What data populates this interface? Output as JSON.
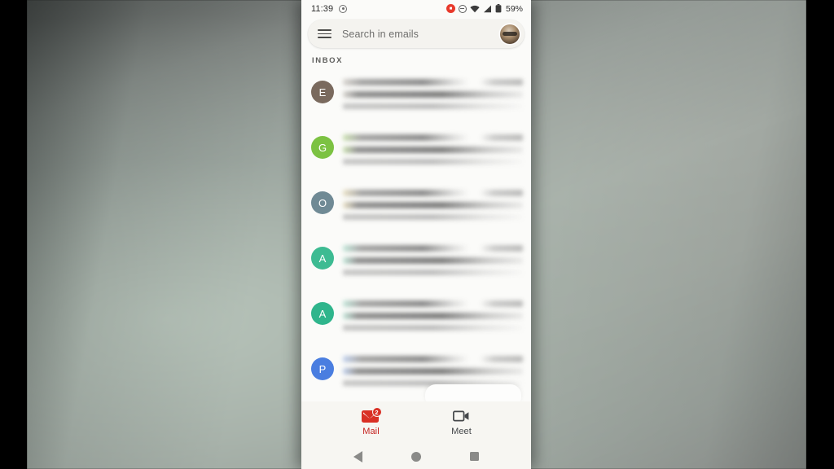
{
  "window": {
    "title": "Gmail Android App Screen Recording"
  },
  "status_bar": {
    "time": "11:39",
    "location_icon": "location-dot-icon",
    "recording_icon": "screen-record-icon",
    "dnd_icon": "do-not-disturb-icon",
    "wifi_icon": "wifi-icon",
    "signal_icon": "cell-signal-icon",
    "battery_icon": "battery-icon",
    "battery_text": "59%"
  },
  "search": {
    "menu_icon": "hamburger-menu-icon",
    "placeholder": "Search in emails",
    "value": "",
    "avatar_label": "account-avatar"
  },
  "inbox": {
    "section_label": "INBOX",
    "rows": [
      {
        "initial": "E",
        "color": "#7a6a5e",
        "tint": "rgba(185,178,170,0.55)",
        "blurred": true
      },
      {
        "initial": "G",
        "color": "#7cc242",
        "tint": "rgba(160,205,110,0.55)",
        "blurred": true
      },
      {
        "initial": "O",
        "color": "#708a95",
        "tint": "rgba(222,205,150,0.55)",
        "blurred": true
      },
      {
        "initial": "A",
        "color": "#3dbb92",
        "tint": "rgba(140,215,190,0.55)",
        "blurred": true
      },
      {
        "initial": "A",
        "color": "#2fb58c",
        "tint": "rgba(140,212,188,0.55)",
        "blurred": true
      },
      {
        "initial": "P",
        "color": "#4a7ee0",
        "tint": "rgba(150,180,235,0.6)",
        "blurred": true
      }
    ]
  },
  "bottom_nav": {
    "items": [
      {
        "label": "Mail",
        "icon": "mail-envelope-icon",
        "badge": "2",
        "active": true
      },
      {
        "label": "Meet",
        "icon": "video-camera-icon",
        "badge": "",
        "active": false
      }
    ]
  },
  "android_nav": {
    "back": "back-triangle-icon",
    "home": "home-circle-icon",
    "recents": "recents-square-icon"
  },
  "colors": {
    "accent_red": "#d93025",
    "active_label": "#c5221f",
    "inactive_label": "#44474a",
    "phone_bg": "#fbfbf9",
    "nav_bg": "#f7f6f2",
    "search_bg": "#f4f3ef"
  }
}
